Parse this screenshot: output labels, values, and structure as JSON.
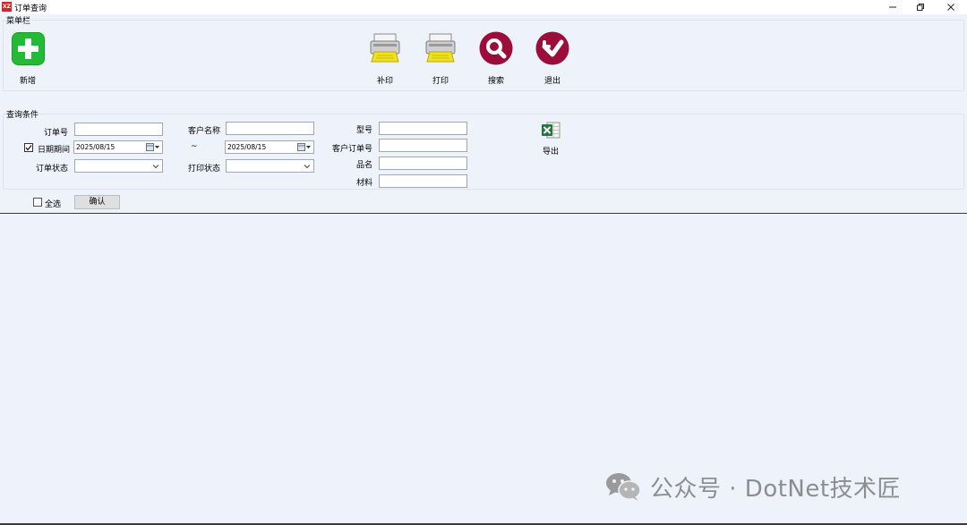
{
  "window": {
    "title": "订单查询",
    "icon_text": "XZ",
    "controls": [
      "minimize-icon",
      "restore-icon",
      "close-icon"
    ]
  },
  "menu_bar": {
    "legend": "菜单栏",
    "buttons": [
      {
        "label": "新增",
        "icon": "add-icon"
      },
      {
        "label": "补印",
        "icon": "printer-icon"
      },
      {
        "label": "打印",
        "icon": "printer-icon"
      },
      {
        "label": "搜索",
        "icon": "search-icon"
      },
      {
        "label": "退出",
        "icon": "exit-icon"
      }
    ]
  },
  "query": {
    "legend": "查询条件",
    "order_no_label": "订单号",
    "order_no_value": "",
    "date_period_label": "日期期间",
    "date_period_checked": true,
    "date_from": "2025/08/15",
    "date_sep": "~",
    "date_to": "2025/08/15",
    "order_status_label": "订单状态",
    "order_status_value": "",
    "customer_name_label": "客户名称",
    "customer_name_value": "",
    "print_status_label": "打印状态",
    "print_status_value": "",
    "model_label": "型号",
    "model_value": "",
    "customer_order_no_label": "客户订单号",
    "customer_order_no_value": "",
    "product_name_label": "品名",
    "product_name_value": "",
    "material_label": "材料",
    "material_value": "",
    "export_label": "导出",
    "export_icon": "excel-icon"
  },
  "actions": {
    "select_all_label": "全选",
    "select_all_checked": false,
    "confirm_label": "确认"
  },
  "watermark": {
    "text": "公众号 · DotNet技术匠",
    "icon": "wechat-icon"
  },
  "colors": {
    "background": "#eef2fb",
    "add_green": "#22bb33",
    "action_crimson": "#9c0d3a",
    "printer_yellow": "#f2e21b",
    "title_icon_red": "#d9222a",
    "excel_green": "#1d7a3f"
  }
}
